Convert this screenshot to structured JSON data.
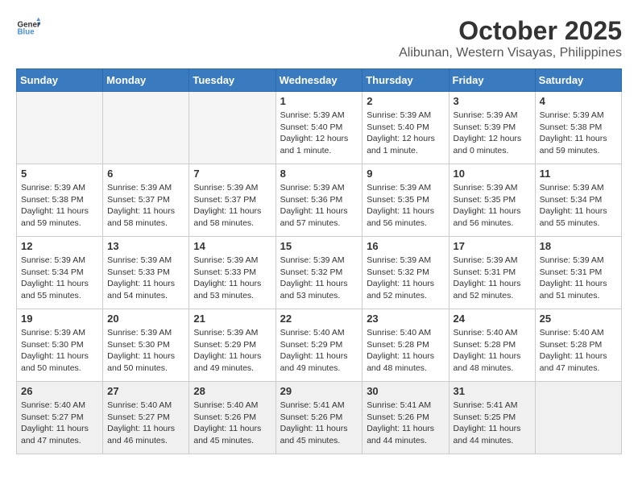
{
  "logo": {
    "general": "General",
    "blue": "Blue"
  },
  "header": {
    "month": "October 2025",
    "location": "Alibunan, Western Visayas, Philippines"
  },
  "weekdays": [
    "Sunday",
    "Monday",
    "Tuesday",
    "Wednesday",
    "Thursday",
    "Friday",
    "Saturday"
  ],
  "weeks": [
    [
      {
        "day": "",
        "info": ""
      },
      {
        "day": "",
        "info": ""
      },
      {
        "day": "",
        "info": ""
      },
      {
        "day": "1",
        "info": "Sunrise: 5:39 AM\nSunset: 5:40 PM\nDaylight: 12 hours\nand 1 minute."
      },
      {
        "day": "2",
        "info": "Sunrise: 5:39 AM\nSunset: 5:40 PM\nDaylight: 12 hours\nand 1 minute."
      },
      {
        "day": "3",
        "info": "Sunrise: 5:39 AM\nSunset: 5:39 PM\nDaylight: 12 hours\nand 0 minutes."
      },
      {
        "day": "4",
        "info": "Sunrise: 5:39 AM\nSunset: 5:38 PM\nDaylight: 11 hours\nand 59 minutes."
      }
    ],
    [
      {
        "day": "5",
        "info": "Sunrise: 5:39 AM\nSunset: 5:38 PM\nDaylight: 11 hours\nand 59 minutes."
      },
      {
        "day": "6",
        "info": "Sunrise: 5:39 AM\nSunset: 5:37 PM\nDaylight: 11 hours\nand 58 minutes."
      },
      {
        "day": "7",
        "info": "Sunrise: 5:39 AM\nSunset: 5:37 PM\nDaylight: 11 hours\nand 58 minutes."
      },
      {
        "day": "8",
        "info": "Sunrise: 5:39 AM\nSunset: 5:36 PM\nDaylight: 11 hours\nand 57 minutes."
      },
      {
        "day": "9",
        "info": "Sunrise: 5:39 AM\nSunset: 5:35 PM\nDaylight: 11 hours\nand 56 minutes."
      },
      {
        "day": "10",
        "info": "Sunrise: 5:39 AM\nSunset: 5:35 PM\nDaylight: 11 hours\nand 56 minutes."
      },
      {
        "day": "11",
        "info": "Sunrise: 5:39 AM\nSunset: 5:34 PM\nDaylight: 11 hours\nand 55 minutes."
      }
    ],
    [
      {
        "day": "12",
        "info": "Sunrise: 5:39 AM\nSunset: 5:34 PM\nDaylight: 11 hours\nand 55 minutes."
      },
      {
        "day": "13",
        "info": "Sunrise: 5:39 AM\nSunset: 5:33 PM\nDaylight: 11 hours\nand 54 minutes."
      },
      {
        "day": "14",
        "info": "Sunrise: 5:39 AM\nSunset: 5:33 PM\nDaylight: 11 hours\nand 53 minutes."
      },
      {
        "day": "15",
        "info": "Sunrise: 5:39 AM\nSunset: 5:32 PM\nDaylight: 11 hours\nand 53 minutes."
      },
      {
        "day": "16",
        "info": "Sunrise: 5:39 AM\nSunset: 5:32 PM\nDaylight: 11 hours\nand 52 minutes."
      },
      {
        "day": "17",
        "info": "Sunrise: 5:39 AM\nSunset: 5:31 PM\nDaylight: 11 hours\nand 52 minutes."
      },
      {
        "day": "18",
        "info": "Sunrise: 5:39 AM\nSunset: 5:31 PM\nDaylight: 11 hours\nand 51 minutes."
      }
    ],
    [
      {
        "day": "19",
        "info": "Sunrise: 5:39 AM\nSunset: 5:30 PM\nDaylight: 11 hours\nand 50 minutes."
      },
      {
        "day": "20",
        "info": "Sunrise: 5:39 AM\nSunset: 5:30 PM\nDaylight: 11 hours\nand 50 minutes."
      },
      {
        "day": "21",
        "info": "Sunrise: 5:39 AM\nSunset: 5:29 PM\nDaylight: 11 hours\nand 49 minutes."
      },
      {
        "day": "22",
        "info": "Sunrise: 5:40 AM\nSunset: 5:29 PM\nDaylight: 11 hours\nand 49 minutes."
      },
      {
        "day": "23",
        "info": "Sunrise: 5:40 AM\nSunset: 5:28 PM\nDaylight: 11 hours\nand 48 minutes."
      },
      {
        "day": "24",
        "info": "Sunrise: 5:40 AM\nSunset: 5:28 PM\nDaylight: 11 hours\nand 48 minutes."
      },
      {
        "day": "25",
        "info": "Sunrise: 5:40 AM\nSunset: 5:28 PM\nDaylight: 11 hours\nand 47 minutes."
      }
    ],
    [
      {
        "day": "26",
        "info": "Sunrise: 5:40 AM\nSunset: 5:27 PM\nDaylight: 11 hours\nand 47 minutes."
      },
      {
        "day": "27",
        "info": "Sunrise: 5:40 AM\nSunset: 5:27 PM\nDaylight: 11 hours\nand 46 minutes."
      },
      {
        "day": "28",
        "info": "Sunrise: 5:40 AM\nSunset: 5:26 PM\nDaylight: 11 hours\nand 45 minutes."
      },
      {
        "day": "29",
        "info": "Sunrise: 5:41 AM\nSunset: 5:26 PM\nDaylight: 11 hours\nand 45 minutes."
      },
      {
        "day": "30",
        "info": "Sunrise: 5:41 AM\nSunset: 5:26 PM\nDaylight: 11 hours\nand 44 minutes."
      },
      {
        "day": "31",
        "info": "Sunrise: 5:41 AM\nSunset: 5:25 PM\nDaylight: 11 hours\nand 44 minutes."
      },
      {
        "day": "",
        "info": ""
      }
    ]
  ]
}
